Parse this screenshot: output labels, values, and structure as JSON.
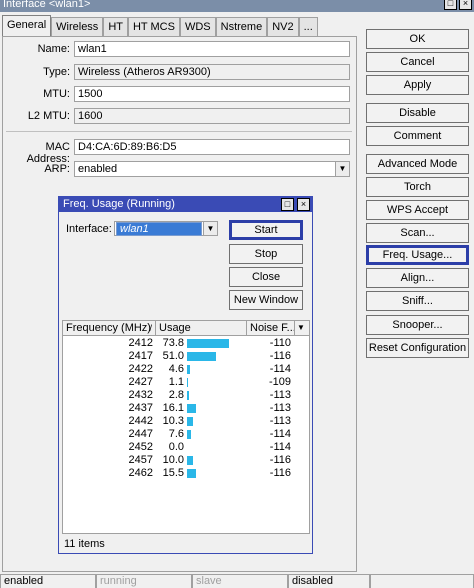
{
  "window": {
    "title": "Interface <wlan1>",
    "controls": [
      "□",
      "×"
    ]
  },
  "tabs": [
    "General",
    "Wireless",
    "HT",
    "HT MCS",
    "WDS",
    "Nstreme",
    "NV2",
    "..."
  ],
  "general": {
    "name_label": "Name:",
    "name_value": "wlan1",
    "type_label": "Type:",
    "type_value": "Wireless (Atheros AR9300)",
    "mtu_label": "MTU:",
    "mtu_value": "1500",
    "l2mtu_label": "L2 MTU:",
    "l2mtu_value": "1600",
    "mac_label": "MAC Address:",
    "mac_value": "D4:CA:6D:89:B6:D5",
    "arp_label": "ARP:",
    "arp_value": "enabled"
  },
  "buttons": {
    "ok": "OK",
    "cancel": "Cancel",
    "apply": "Apply",
    "disable": "Disable",
    "comment": "Comment",
    "advanced_mode": "Advanced Mode",
    "torch": "Torch",
    "wps_accept": "WPS Accept",
    "scan": "Scan...",
    "freq_usage": "Freq. Usage...",
    "align": "Align...",
    "sniff": "Sniff...",
    "snooper": "Snooper...",
    "reset_config": "Reset Configuration"
  },
  "dialog": {
    "title": "Freq. Usage (Running)",
    "controls": [
      "□",
      "×"
    ],
    "interface_label": "Interface:",
    "interface_value": "wlan1",
    "start": "Start",
    "stop": "Stop",
    "close": "Close",
    "new_window": "New Window",
    "columns": [
      "Frequency (MHz)",
      "Usage",
      "Noise F..."
    ],
    "sort_indicator": "/",
    "rows": [
      {
        "freq": "2412",
        "usage": "73.8",
        "usage_pct": 73.8,
        "noise": "-110"
      },
      {
        "freq": "2417",
        "usage": "51.0",
        "usage_pct": 51.0,
        "noise": "-116"
      },
      {
        "freq": "2422",
        "usage": "4.6",
        "usage_pct": 4.6,
        "noise": "-114"
      },
      {
        "freq": "2427",
        "usage": "1.1",
        "usage_pct": 1.1,
        "noise": "-109"
      },
      {
        "freq": "2432",
        "usage": "2.8",
        "usage_pct": 2.8,
        "noise": "-113"
      },
      {
        "freq": "2437",
        "usage": "16.1",
        "usage_pct": 16.1,
        "noise": "-113"
      },
      {
        "freq": "2442",
        "usage": "10.3",
        "usage_pct": 10.3,
        "noise": "-113"
      },
      {
        "freq": "2447",
        "usage": "7.6",
        "usage_pct": 7.6,
        "noise": "-114"
      },
      {
        "freq": "2452",
        "usage": "0.0",
        "usage_pct": 0.0,
        "noise": "-114"
      },
      {
        "freq": "2457",
        "usage": "10.0",
        "usage_pct": 10.0,
        "noise": "-116"
      },
      {
        "freq": "2462",
        "usage": "15.5",
        "usage_pct": 15.5,
        "noise": "-116"
      }
    ],
    "item_count": "11 items"
  },
  "status_bar": [
    "enabled",
    "running",
    "slave",
    "disabled"
  ],
  "colors": {
    "accent": "#3a4bb5",
    "usage_bar": "#2ab7e8",
    "selection": "#3a7bd5"
  }
}
